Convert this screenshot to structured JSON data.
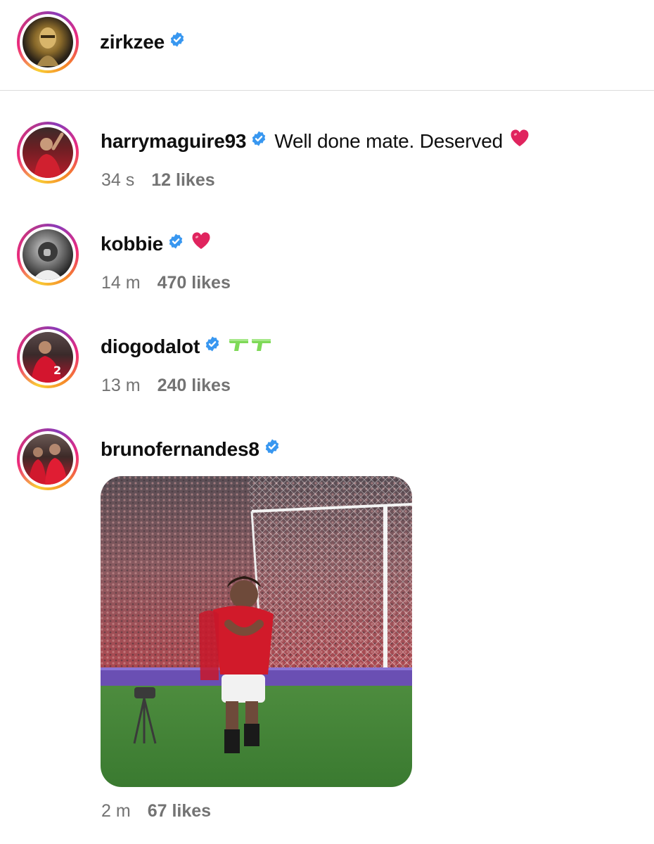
{
  "post": {
    "author": "zirkzee"
  },
  "comments": [
    {
      "username": "harrymaguire93",
      "text": "Well done mate. Deserved",
      "emoji": "red-heart",
      "time": "34 s",
      "likes": "12 likes"
    },
    {
      "username": "kobbie",
      "text": "",
      "emoji": "red-heart",
      "time": "14 m",
      "likes": "470 likes"
    },
    {
      "username": "diogodalot",
      "text": "",
      "emoji": "water-pistol-x2",
      "time": "13 m",
      "likes": "240 likes"
    },
    {
      "username": "brunofernandes8",
      "text": "",
      "emoji": "",
      "media": "celebration-gif",
      "time": "2 m",
      "likes": "67 likes"
    }
  ],
  "colors": {
    "verified": "#3897f0",
    "meta_text": "#737373",
    "heart": "#e0245e"
  }
}
